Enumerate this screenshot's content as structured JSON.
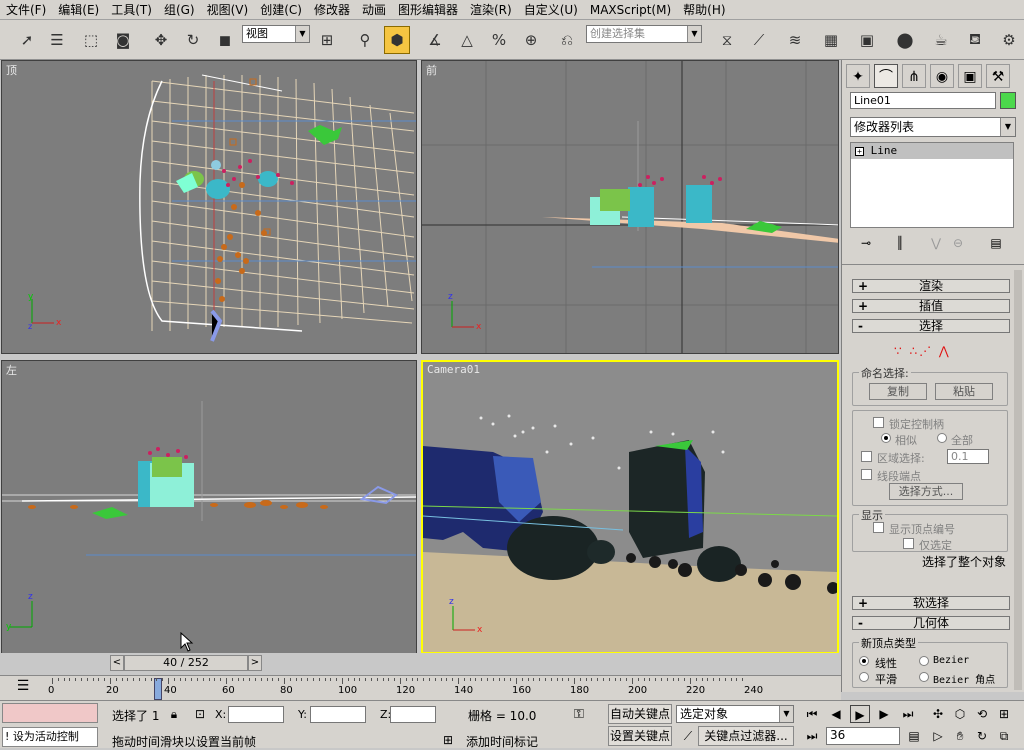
{
  "menus": [
    "文件(F)",
    "编辑(E)",
    "工具(T)",
    "组(G)",
    "视图(V)",
    "创建(C)",
    "修改器",
    "动画",
    "图形编辑器",
    "渲染(R)",
    "自定义(U)",
    "MAXScript(M)",
    "帮助(H)"
  ],
  "toolbar": {
    "view_select": "视图",
    "named_selection_placeholder": "创建选择集"
  },
  "viewports": {
    "top": "顶",
    "front": "前",
    "left": "左",
    "camera": "Camera01"
  },
  "panel": {
    "object_name": "Line01",
    "object_color": "#4cd84c",
    "modifier_list": "修改器列表",
    "stack_item": "Line",
    "rollout_render": "渲染",
    "rollout_interp": "插值",
    "rollout_select": "选择",
    "named_sel_title": "命名选择:",
    "copy": "复制",
    "paste": "粘贴",
    "lock_handles": "锁定控制柄",
    "similar": "相似",
    "all": "全部",
    "area_select": "区域选择:",
    "area_value": "0.1",
    "segment_end": "线段端点",
    "select_by": "选择方式...",
    "display_title": "显示",
    "show_vertex_numbers": "显示顶点编号",
    "selected_only": "仅选定",
    "status": "选择了整个对象",
    "rollout_soft": "软选择",
    "rollout_geom": "几何体",
    "new_vertex_type": "新顶点类型",
    "linear": "线性",
    "bezier": "Bezier",
    "smooth": "平滑",
    "bezier_corner": "Bezier 角点"
  },
  "timeline": {
    "frame_display": "40 / 252",
    "ticks": [
      "0",
      "20",
      "40",
      "60",
      "80",
      "100",
      "120",
      "140",
      "160",
      "180",
      "200",
      "220",
      "240"
    ]
  },
  "status": {
    "selected": "选择了 1",
    "x_label": "X:",
    "y_label": "Y:",
    "z_label": "Z:",
    "grid": "栅格 = 10.0",
    "auto_key": "自动关键点",
    "set_key": "设置关键点",
    "selected_object": "选定对象",
    "key_filters": "关键点过滤器...",
    "frame": "36",
    "active_control": "设为活动控制",
    "prompt": "拖动时间滑块以设置当前帧",
    "add_time_tag": "添加时间标记"
  },
  "colors": {
    "accent": "#ffff00",
    "viewport_bg": "#7d7d7d",
    "ui": "#d6d3ce"
  }
}
